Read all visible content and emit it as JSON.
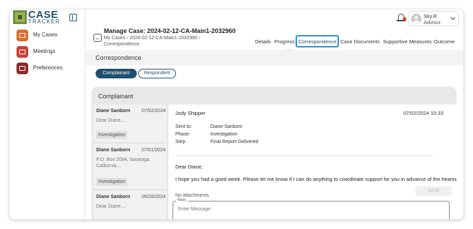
{
  "app": {
    "logo_case": "CASE",
    "logo_tracker": "TRACKER"
  },
  "sidebar": {
    "items": [
      {
        "label": "My Cases",
        "icon": "briefcase-icon",
        "color": "#e06b2a"
      },
      {
        "label": "Meetings",
        "icon": "video-icon",
        "color": "#c9403a"
      },
      {
        "label": "Preferences",
        "icon": "gear-icon",
        "color": "#8c2a2a"
      }
    ]
  },
  "topbar": {
    "user_name": "Sky.R",
    "user_role": "Advisor"
  },
  "case": {
    "title": "Manage Case: 2024-02-12-CA-Main1-2032960",
    "breadcrumb": "My Cases › 2024-02-12-CA-Main1-2032960 › Correspondence"
  },
  "tabs": [
    {
      "label": "Details"
    },
    {
      "label": "Progress"
    },
    {
      "label": "Correspondence",
      "active": true
    },
    {
      "label": "Case Documents"
    },
    {
      "label": "Supportive Measures"
    },
    {
      "label": "Outcome"
    }
  ],
  "section": {
    "title": "Correspondence",
    "filters": [
      "Complainant",
      "Respondent"
    ]
  },
  "panel": {
    "title": "Complainant",
    "messages": [
      {
        "name": "Diane Sanborn",
        "date": "07/02/2024",
        "preview": "Dear Diane,...",
        "tag": "Investigation"
      },
      {
        "name": "Diane Sanborn",
        "date": "07/01/2024",
        "preview": "P.O. Box 2094, Saratoga, California...",
        "tag": "Investigation"
      },
      {
        "name": "Diane Sanborn",
        "date": "05/28/2024",
        "preview": "Dear Diane,..."
      }
    ]
  },
  "detail": {
    "sender": "Jody Shipper",
    "datetime": "07/02/2024 10:33",
    "sent_to_label": "Sent to:",
    "sent_to": "Diane Sanborn",
    "phase_label": "Phase:",
    "phase": "Investigation",
    "step_label": "Step:",
    "step": "Final Report Delivered",
    "greeting": "Dear Diane,",
    "body": "I hope you had a good week. Please let me know if I can do anything to coordinate support for you in advance of the hearing",
    "attachments": "No attachments",
    "reply_label": "Reply",
    "reply_placeholder": "Enter Message",
    "send_label": "Send"
  },
  "colors": {
    "brand": "#1f4f6f",
    "highlight": "#2a8fd8",
    "alert_dot": "#e53935"
  }
}
